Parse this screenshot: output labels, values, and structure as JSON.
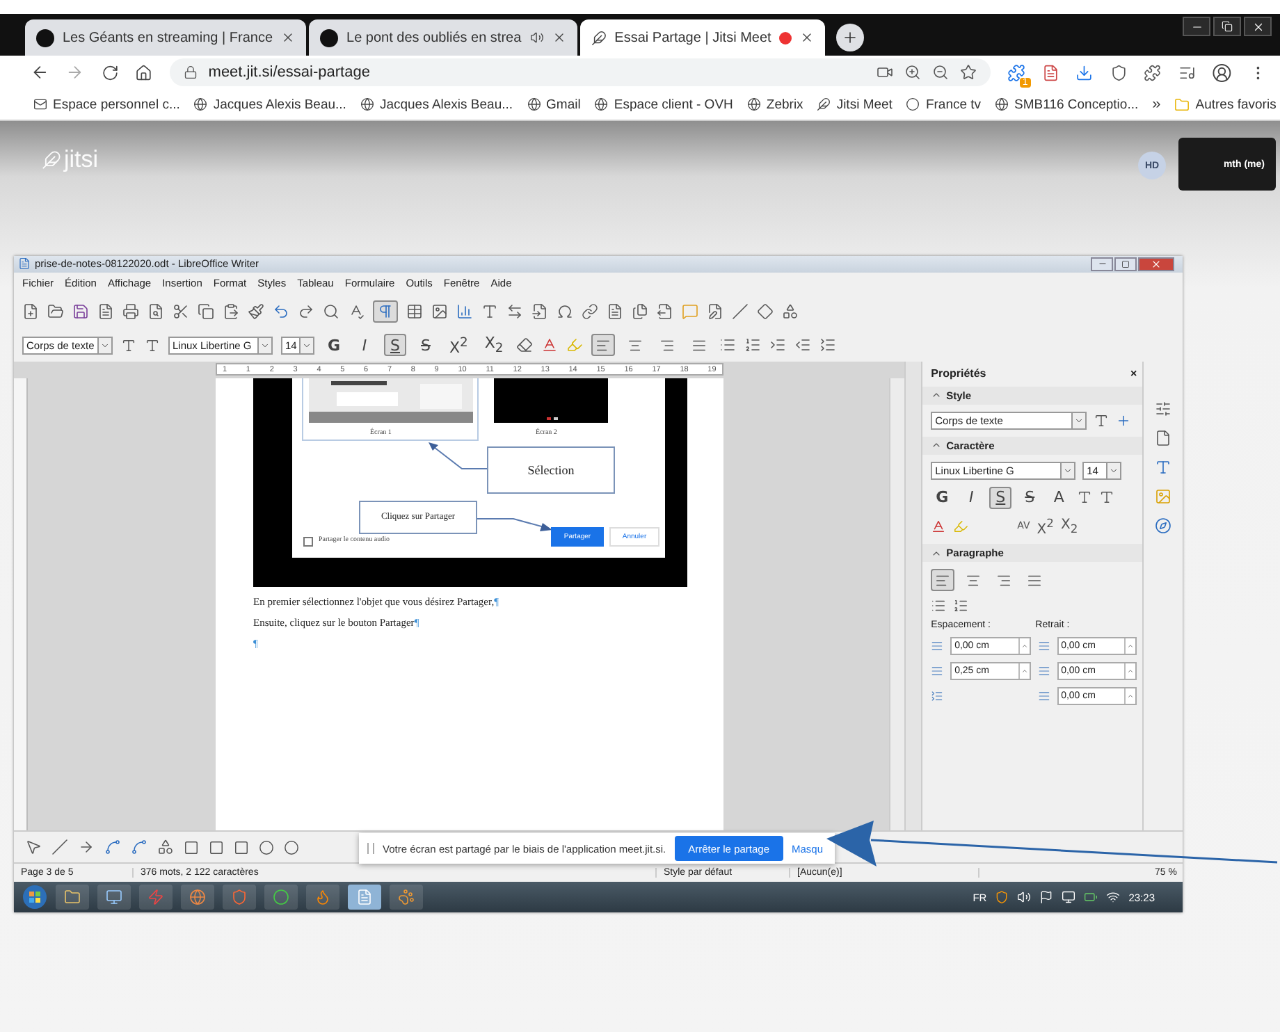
{
  "browser": {
    "tabs": [
      {
        "title": "Les Géants en streaming | France",
        "selected": false,
        "audio": false,
        "recording": false
      },
      {
        "title": "Le pont des oubliés en strea",
        "selected": false,
        "audio": true,
        "recording": false
      },
      {
        "title": "Essai Partage | Jitsi Meet",
        "selected": true,
        "audio": false,
        "recording": true
      }
    ],
    "address": "meet.jit.si/essai-partage",
    "extension_badge": "1",
    "bookmarks": [
      "Espace personnel c...",
      "Jacques Alexis Beau...",
      "Jacques Alexis Beau...",
      "Gmail",
      "Espace client - OVH",
      "Zebrix",
      "Jitsi Meet",
      "France tv",
      "SMB116 Conceptio..."
    ],
    "more": "»",
    "other_bookmarks": "Autres favoris"
  },
  "jitsi": {
    "logo": "jitsi",
    "avatar": "HD",
    "self_view": "mth (me)"
  },
  "writer": {
    "title": "prise-de-notes-08122020.odt - LibreOffice Writer",
    "menus": [
      "Fichier",
      "Édition",
      "Affichage",
      "Insertion",
      "Format",
      "Styles",
      "Tableau",
      "Formulaire",
      "Outils",
      "Fenêtre",
      "Aide"
    ],
    "formatting_marks": true,
    "paragraph_style": "Corps de texte",
    "font": "Linux Libertine G",
    "size": "14",
    "format_buttons": [
      {
        "label": "G",
        "pressed": false
      },
      {
        "label": "I",
        "pressed": false
      },
      {
        "label": "S",
        "pressed": true
      },
      {
        "label": "S",
        "pressed": false
      }
    ],
    "superscript": "X$^{2}$",
    "subscript": "X$_{2}$",
    "alignment": [
      {
        "selected": true
      },
      {
        "selected": false
      },
      {
        "selected": false
      },
      {
        "selected": false
      }
    ],
    "ruler": [
      "1",
      "1",
      "2",
      "3",
      "4",
      "5",
      "6",
      "7",
      "8",
      "9",
      "10",
      "11",
      "12",
      "13",
      "14",
      "15",
      "16",
      "17",
      "18",
      "19"
    ],
    "figure": {
      "screens": [
        "Écran 1",
        "Écran 2"
      ],
      "callouts": [
        "Sélection",
        "Cliquez sur Partager"
      ],
      "audio_option": "Partager le contenu audio",
      "audio_checked": false,
      "buttons": [
        {
          "label": "Partager",
          "primary": true
        },
        {
          "label": "Annuler",
          "primary": false
        }
      ]
    },
    "paragraphs": [
      {
        "text": "En premier sélectionnez l'objet que vous désirez Partager,",
        "mark": "¶"
      },
      {
        "text": "Ensuite, cliquez sur le bouton Partager",
        "mark": "¶"
      },
      {
        "mark": "¶"
      }
    ],
    "sidebar": {
      "title": "Propriétés",
      "close": "×",
      "style": {
        "heading": "Style",
        "value": "Corps de texte"
      },
      "character": {
        "heading": "Caractère",
        "font": "Linux Libertine G",
        "size": "14",
        "buttons": [
          {
            "label": "G",
            "pressed": false
          },
          {
            "label": "I",
            "pressed": false
          },
          {
            "label": "S",
            "pressed": true
          },
          {
            "label": "S",
            "pressed": false
          },
          {
            "label": "A",
            "pressed": false
          }
        ],
        "spacing": "AV",
        "superscript": "X$^{2}$",
        "subscript": "X$_{2}$"
      },
      "paragraph": {
        "heading": "Paragraphe",
        "alignment": [
          {
            "selected": true
          },
          {
            "selected": false
          },
          {
            "selected": false
          },
          {
            "selected": false
          }
        ],
        "spacing_label": "Espacement :",
        "indent_label": "Retrait :",
        "above": "0,00 cm",
        "below": "0,25 cm",
        "indent_before": "0,00 cm",
        "indent_after": "0,00 cm",
        "first_line": "0,00 cm"
      }
    },
    "status": [
      "Page 3 de 5",
      "376 mots, 2 122 caractères",
      "Style par défaut",
      "[Aucun(e)]"
    ],
    "zoom": "75 %",
    "language": "FR",
    "clock": "23:23"
  },
  "share_banner": {
    "message": "Votre écran est partagé par le biais de l'application meet.jit.si.",
    "stop": "Arrêter le partage",
    "hide": "Masqu"
  }
}
